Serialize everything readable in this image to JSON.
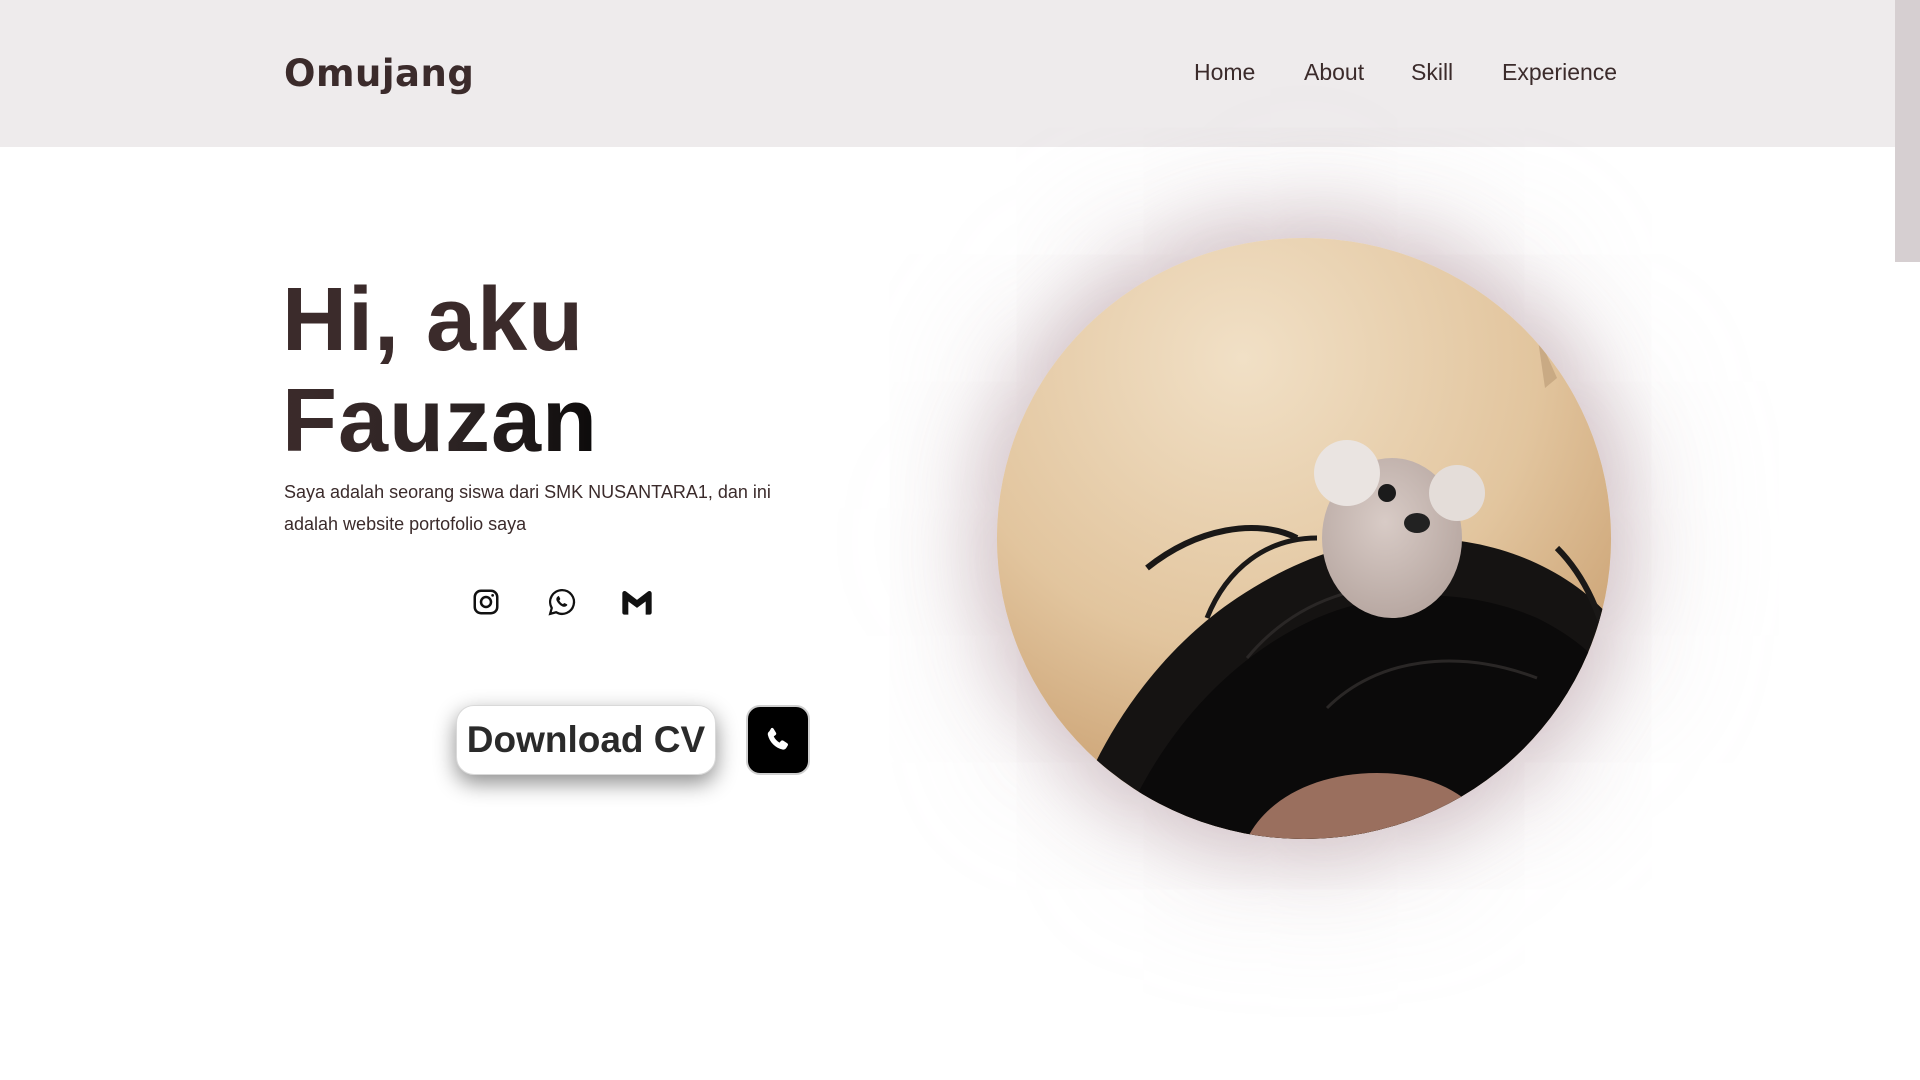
{
  "header": {
    "logo": "Omujang",
    "nav": [
      {
        "label": "Home"
      },
      {
        "label": "About"
      },
      {
        "label": "Skill"
      },
      {
        "label": "Experience"
      }
    ]
  },
  "hero": {
    "title_line1": "Hi, aku",
    "title_line2": "Fauzan",
    "description": "Saya adalah seorang siswa dari SMK NUSANTARA1, dan ini adalah website portofolio saya",
    "socials": [
      {
        "icon": "instagram-icon"
      },
      {
        "icon": "whatsapp-icon"
      },
      {
        "icon": "gmail-icon"
      }
    ],
    "download_cv_label": "Download CV",
    "call_icon": "phone-icon"
  },
  "colors": {
    "header_bg": "#eeebec",
    "text": "#3b2b2b",
    "scrollbar_thumb": "#d6cfd1",
    "call_button_bg": "#000000"
  }
}
